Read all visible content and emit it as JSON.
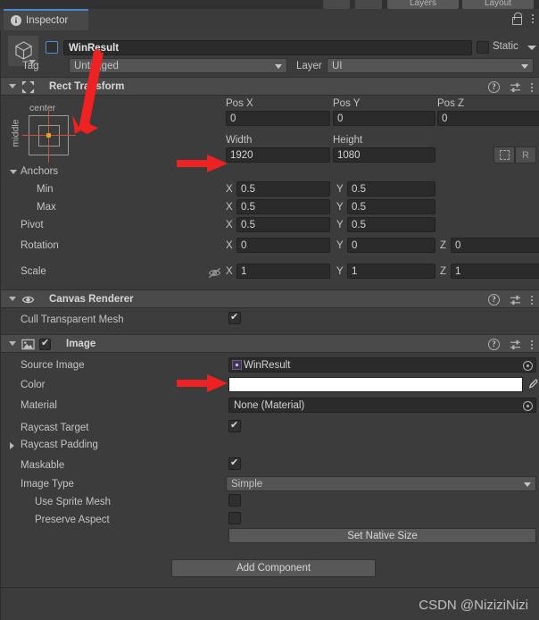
{
  "toolbar": {
    "buttons": [
      "",
      "",
      "Layers",
      "Layout"
    ]
  },
  "tab": {
    "label": "Inspector",
    "info_icon": "info-icon",
    "lock_icon": "lock-icon",
    "menu_icon": "kebab-menu-icon"
  },
  "object_header": {
    "name": "WinResult",
    "active": false,
    "static_label": "Static",
    "static_checked": false,
    "tag_label": "Tag",
    "tag_value": "Untagged",
    "layer_label": "Layer",
    "layer_value": "UI"
  },
  "rect_transform": {
    "title": "Rect Transform",
    "anchor_preset": {
      "horizontal": "center",
      "vertical": "middle"
    },
    "pos_x_label": "Pos X",
    "pos_y_label": "Pos Y",
    "pos_z_label": "Pos Z",
    "pos_x": "0",
    "pos_y": "0",
    "pos_z": "0",
    "width_label": "Width",
    "height_label": "Height",
    "width": "1920",
    "height": "1080",
    "blueprint_label": "",
    "raw_label": "R",
    "anchors_label": "Anchors",
    "min_label": "Min",
    "max_label": "Max",
    "pivot_label": "Pivot",
    "anchor_min_x": "0.5",
    "anchor_min_y": "0.5",
    "anchor_max_x": "0.5",
    "anchor_max_y": "0.5",
    "pivot_x": "0.5",
    "pivot_y": "0.5",
    "rotation_label": "Rotation",
    "rotation_x": "0",
    "rotation_y": "0",
    "rotation_z": "0",
    "scale_label": "Scale",
    "scale_x": "1",
    "scale_y": "1",
    "scale_z": "1",
    "axis_x": "X",
    "axis_y": "Y",
    "axis_z": "Z"
  },
  "canvas_renderer": {
    "title": "Canvas Renderer",
    "cull_label": "Cull Transparent Mesh",
    "cull_checked": true
  },
  "image": {
    "title": "Image",
    "enabled": true,
    "source_image_label": "Source Image",
    "source_image_value": "WinResult",
    "color_label": "Color",
    "color_value": "#FFFFFF",
    "material_label": "Material",
    "material_value": "None (Material)",
    "raycast_target_label": "Raycast Target",
    "raycast_target_checked": true,
    "raycast_padding_label": "Raycast Padding",
    "maskable_label": "Maskable",
    "maskable_checked": true,
    "image_type_label": "Image Type",
    "image_type_value": "Simple",
    "use_sprite_mesh_label": "Use Sprite Mesh",
    "use_sprite_mesh_checked": false,
    "preserve_aspect_label": "Preserve Aspect",
    "preserve_aspect_checked": false,
    "set_native_size_label": "Set Native Size"
  },
  "add_component_label": "Add Component",
  "watermark": "CSDN @NiziziNizi"
}
